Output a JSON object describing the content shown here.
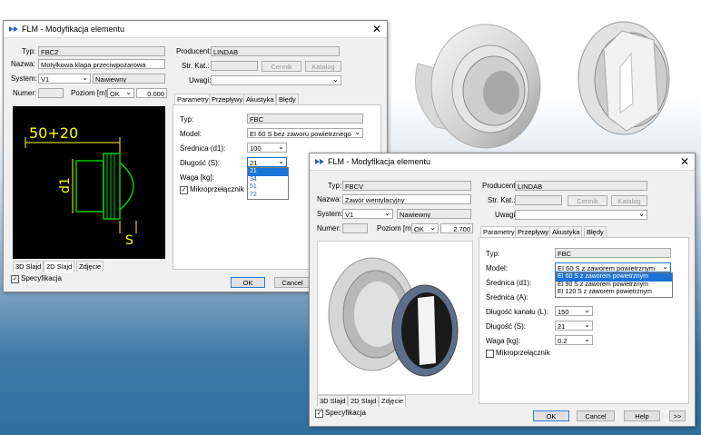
{
  "win1": {
    "title": "FLM - Modyfikacja elementu",
    "typ_label": "Typ:",
    "typ_value": "FBC2",
    "nazwa_label": "Nazwa:",
    "nazwa_value": "Motylkowa klapa przeciwpożarowa",
    "system_label": "System:",
    "system_value": "V1",
    "system_type": "Nawiewny",
    "numer_label": "Numer:",
    "poziom_label": "Poziom [m]:",
    "poziom_ok": "OK",
    "poziom_value": "0.000",
    "producent_label": "Producent:",
    "producent_value": "LINDAB",
    "strkat_label": "Str. Kat.:",
    "cennik": "Cennik",
    "katalog": "Katalog",
    "uwagi_label": "Uwagi:",
    "tabs": [
      "Parametry",
      "Przepływy",
      "Akustyka",
      "Błędy"
    ],
    "param_typ_label": "Typ:",
    "param_typ_value": "FBC",
    "model_label": "Model:",
    "model_value": "EI 60 S bez zaworu powietrznego",
    "srednica_label": "Średnica (d1):",
    "srednica_value": "100",
    "dlugosc_label": "Długość (S):",
    "dlugosc_value": "21",
    "dlugosc_options": [
      "21",
      "34",
      "51",
      "72"
    ],
    "waga_label": "Waga [kg]:",
    "mikro_label": "Mikroprzełącznik",
    "drawing_dim1": "50+20",
    "drawing_d1": "d1",
    "drawing_s": "S",
    "view_tabs": [
      "3D Slajd",
      "2D Slajd",
      "Zdjęcie"
    ],
    "spec_label": "Specyfikacja",
    "ok": "OK",
    "cancel": "Cancel"
  },
  "win2": {
    "title": "FLM - Modyfikacja elementu",
    "typ_label": "Typ:",
    "typ_value": "FBCV",
    "nazwa_label": "Nazwa:",
    "nazwa_value": "Zawór wentylacyjny",
    "system_label": "System:",
    "system_value": "V1",
    "system_type": "Nawiewny",
    "numer_label": "Numer:",
    "poziom_label": "Poziom [m]:",
    "poziom_ok": "OK",
    "poziom_value": "2.700",
    "producent_label": "Producent:",
    "producent_value": "LINDAB",
    "strkat_label": "Str. Kat.:",
    "cennik": "Cennik",
    "katalog": "Katalog",
    "uwagi_label": "Uwagi:",
    "tabs": [
      "Parametry",
      "Przepływy",
      "Akustyka",
      "Błędy"
    ],
    "param_typ_label": "Typ:",
    "param_typ_value": "FBC",
    "model_label": "Model:",
    "model_value": "EI 60 S z zaworem powietrznym",
    "model_options": [
      "EI 60 S z zaworem powietrznym",
      "EI 90 S z zaworem powietrznym",
      "EI 120 S z zaworem powietrznym"
    ],
    "srednica_label": "Średnica (d1):",
    "srednica_a_label": "Średnica (A):",
    "kanal_label": "Długość kanału (L):",
    "kanal_value": "150",
    "dlugosc_label": "Długość (S):",
    "dlugosc_value": "21",
    "waga_label": "Waga [kg]:",
    "waga_value": "0.2",
    "mikro_label": "Mikroprzełącznik",
    "view_tabs": [
      "3D Slajd",
      "2D Slajd",
      "Zdjęcie"
    ],
    "spec_label": "Specyfikacja",
    "ok": "OK",
    "cancel": "Cancel",
    "help": "Help",
    "more": ">>"
  },
  "colors": {
    "accent": "#1a73d9",
    "drawing_bg": "#000000",
    "drawing_line": "#ffff00",
    "drawing_part": "#00c000"
  }
}
